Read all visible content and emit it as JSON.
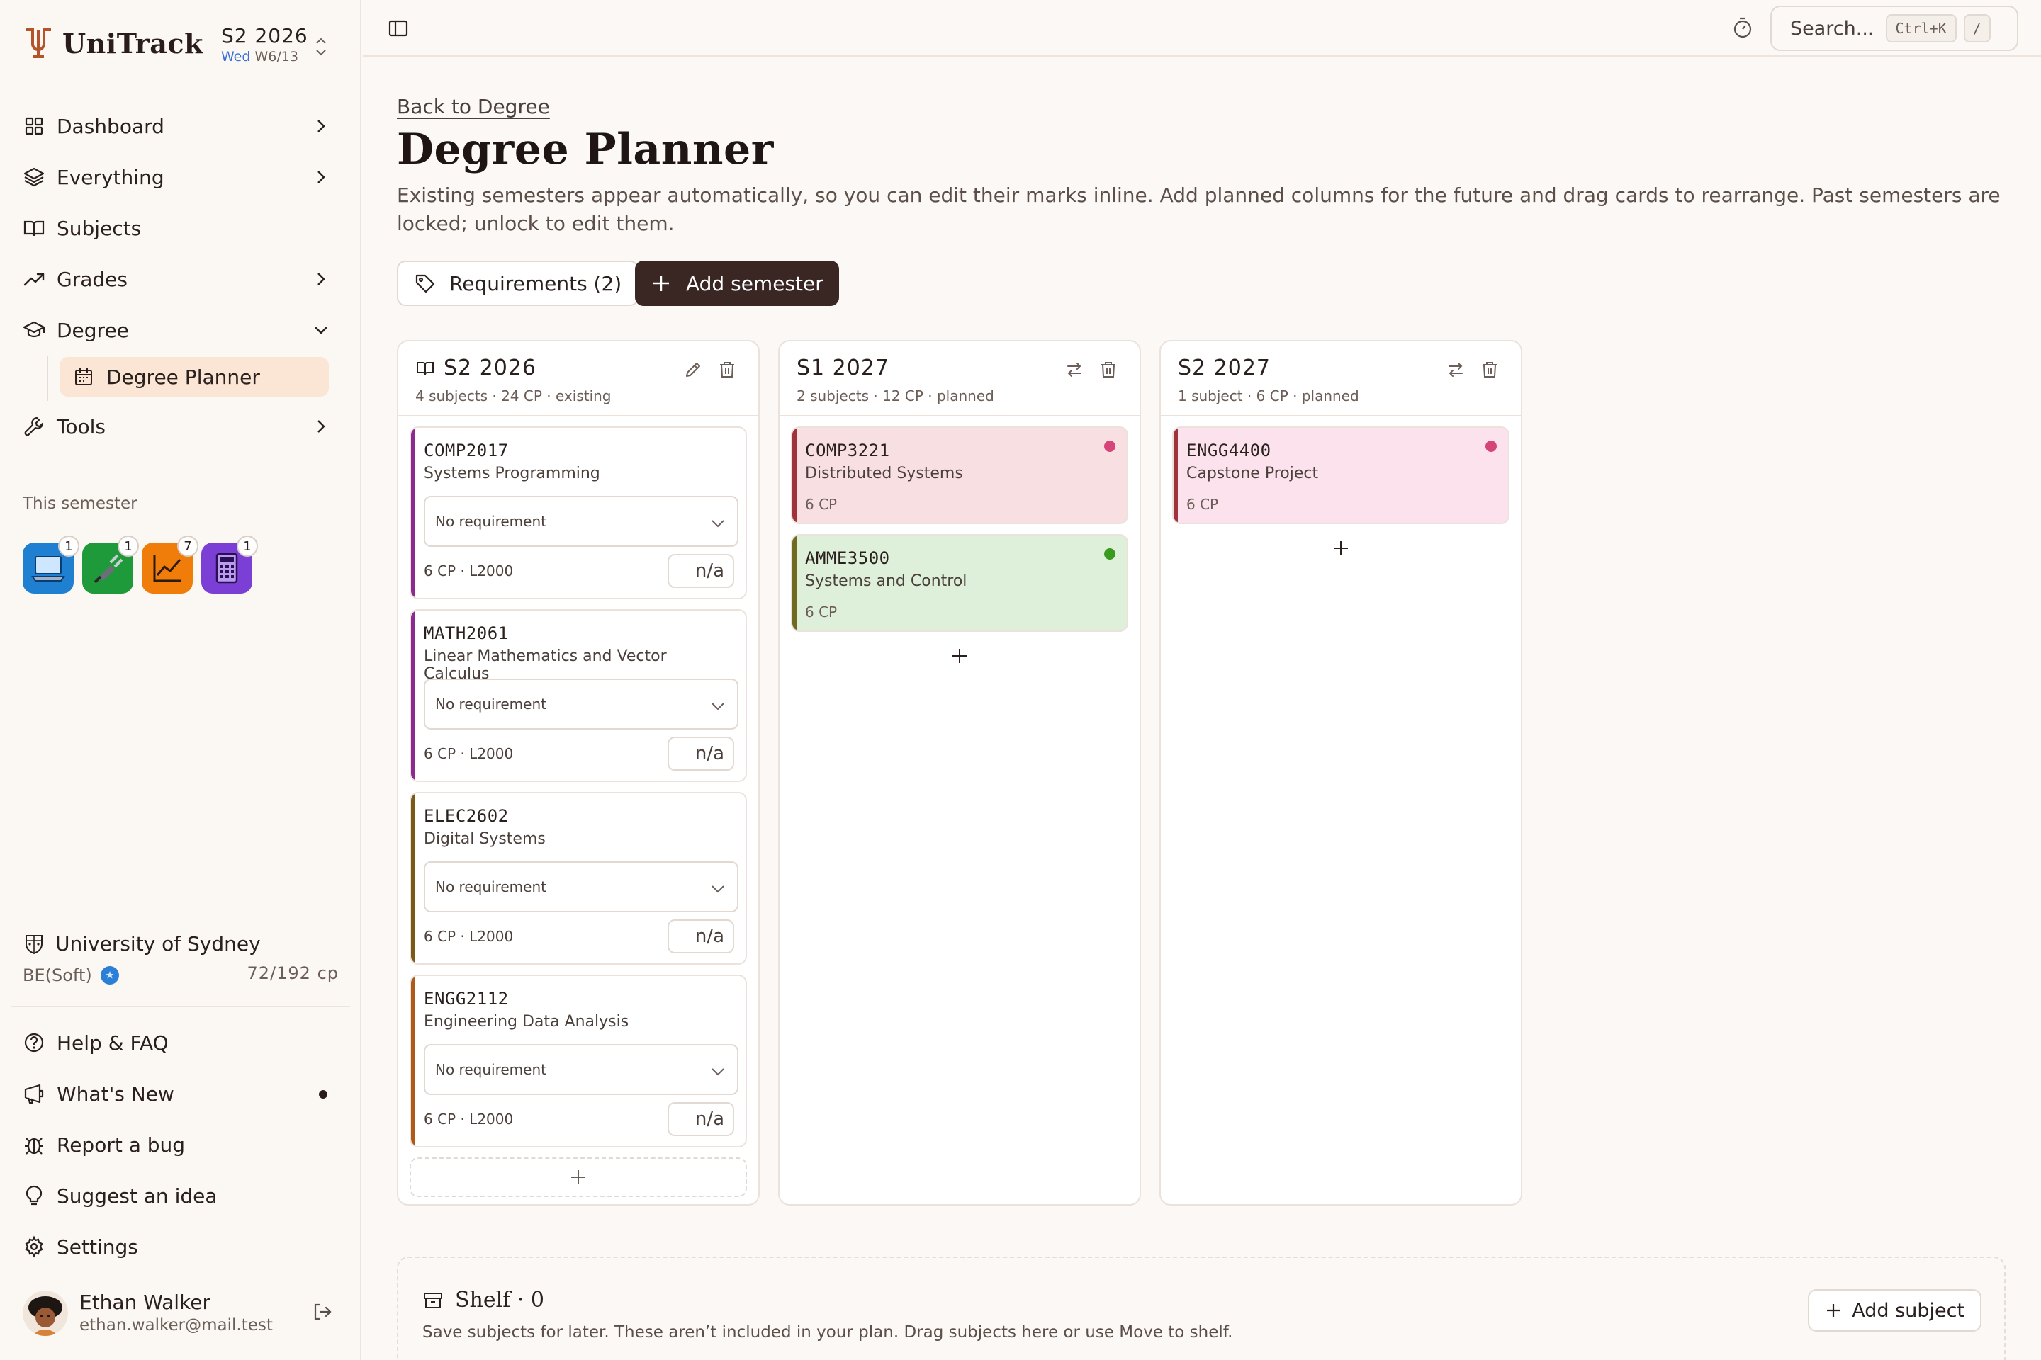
{
  "brand": {
    "name": "UniTrack"
  },
  "semester_switch": {
    "label": "S2 2026",
    "day": "Wed",
    "week": "W6/13"
  },
  "nav": [
    {
      "label": "Dashboard",
      "icon": "grid-icon"
    },
    {
      "label": "Everything",
      "icon": "layers-icon"
    },
    {
      "label": "Subjects",
      "icon": "book-icon"
    },
    {
      "label": "Grades",
      "icon": "trend-icon"
    },
    {
      "label": "Degree",
      "icon": "graduation-cap-icon"
    },
    {
      "label": "Tools",
      "icon": "wrench-icon"
    }
  ],
  "nav_sub": {
    "label": "Degree Planner",
    "icon": "calendar-icon"
  },
  "this_semester": {
    "label": "This semester",
    "apps": [
      {
        "icon": "laptop-icon",
        "badge": "1",
        "color": "#1f7fd1"
      },
      {
        "icon": "plug-icon",
        "badge": "1",
        "color": "#1f9a3a"
      },
      {
        "icon": "chart-icon",
        "badge": "7",
        "color": "#f07c0a"
      },
      {
        "icon": "calculator-icon",
        "badge": "1",
        "color": "#7b3fd6"
      }
    ]
  },
  "university": {
    "name": "University of Sydney",
    "degree": "BE(Soft)",
    "progress": "72/192 cp"
  },
  "bottom_nav": [
    {
      "label": "Help & FAQ",
      "icon": "help-icon"
    },
    {
      "label": "What's New",
      "icon": "megaphone-icon"
    },
    {
      "label": "Report a bug",
      "icon": "bug-icon"
    },
    {
      "label": "Suggest an idea",
      "icon": "lightbulb-icon"
    },
    {
      "label": "Settings",
      "icon": "gear-icon"
    }
  ],
  "user": {
    "name": "Ethan Walker",
    "email": "ethan.walker@mail.test"
  },
  "topbar": {
    "search_placeholder": "Search...",
    "shortcut": "Ctrl+K",
    "slash": "/"
  },
  "page": {
    "back": "Back to Degree",
    "title": "Degree Planner",
    "description": "Existing semesters appear automatically, so you can edit their marks inline. Add planned columns for the future and drag cards to rearrange. Past semesters are locked; unlock to edit them.",
    "requirements_button": "Requirements (2)",
    "add_semester_button": "Add semester"
  },
  "columns": [
    {
      "title": "S2 2026",
      "meta": "4 subjects · 24 CP · existing",
      "existing": true,
      "cards": [
        {
          "code": "COMP2017",
          "name": "Systems Programming",
          "requirement": "No requirement",
          "meta": "6 CP · L2000",
          "mark": "n/a",
          "accent": "#8b2a8f"
        },
        {
          "code": "MATH2061",
          "name": "Linear Mathematics and Vector Calculus",
          "requirement": "No requirement",
          "meta": "6 CP · L2000",
          "mark": "n/a",
          "accent": "#8b2a8f"
        },
        {
          "code": "ELEC2602",
          "name": "Digital Systems",
          "requirement": "No requirement",
          "meta": "6 CP · L2000",
          "mark": "n/a",
          "accent": "#7a5a16"
        },
        {
          "code": "ENGG2112",
          "name": "Engineering Data Analysis",
          "requirement": "No requirement",
          "meta": "6 CP · L2000",
          "mark": "n/a",
          "accent": "#b05a1a"
        }
      ]
    },
    {
      "title": "S1 2027",
      "meta": "2 subjects · 12 CP · planned",
      "existing": false,
      "cards": [
        {
          "code": "COMP3221",
          "name": "Distributed Systems",
          "cp": "6 CP",
          "accent": "#a0323c",
          "bg": "#f8dfe1",
          "dot": "#d6457a"
        },
        {
          "code": "AMME3500",
          "name": "Systems and Control",
          "cp": "6 CP",
          "accent": "#6e6a20",
          "bg": "#def0d9",
          "dot": "#3a9a20"
        }
      ]
    },
    {
      "title": "S2 2027",
      "meta": "1 subject · 6 CP · planned",
      "existing": false,
      "cards": [
        {
          "code": "ENGG4400",
          "name": "Capstone Project",
          "cp": "6 CP",
          "accent": "#a0323c",
          "bg": "#fbe2ec",
          "dot": "#d6457a"
        }
      ]
    }
  ],
  "shelf": {
    "title": "Shelf · 0",
    "description": "Save subjects for later. These aren’t included in your plan. Drag subjects here or use Move to shelf.",
    "button": "Add subject"
  }
}
